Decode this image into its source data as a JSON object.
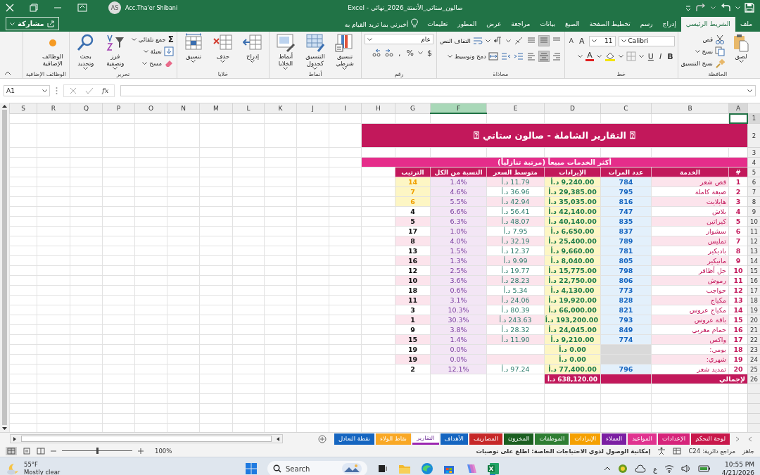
{
  "window": {
    "title": "صالون_ستاتي_الأتمتة_2026_نهائي - Excel",
    "user": "Acc.Tha'er Shibani",
    "avatar": "AS"
  },
  "ribbon_tabs": [
    {
      "label": "ملف",
      "selected": false
    },
    {
      "label": "الشريط الرئيسي",
      "selected": true
    },
    {
      "label": "إدراج",
      "selected": false
    },
    {
      "label": "رسم",
      "selected": false
    },
    {
      "label": "تخطيط الصفحة",
      "selected": false
    },
    {
      "label": "الصيغ",
      "selected": false
    },
    {
      "label": "بيانات",
      "selected": false
    },
    {
      "label": "مراجعة",
      "selected": false
    },
    {
      "label": "عرض",
      "selected": false
    },
    {
      "label": "المطور",
      "selected": false
    },
    {
      "label": "تعليمات",
      "selected": false
    }
  ],
  "tell_me": "أخبرني بما تريد القيام به",
  "share": "مشاركة",
  "ribbon_groups": [
    {
      "kind": "clipboard",
      "label": "الحافظة",
      "paste": "لصق",
      "items": [
        "قص",
        "نسخ",
        "نسخ التنسيق"
      ]
    },
    {
      "kind": "font",
      "label": "خط",
      "font": "Calibri",
      "size": "11",
      "grow": "A",
      "shrink": "A",
      "bold": "B",
      "italic": "I",
      "underline": "U",
      "font_color": "A"
    },
    {
      "kind": "alignment",
      "label": "محاذاة",
      "wrap": "التفاف النص",
      "merge": "دمج وتوسيط"
    },
    {
      "kind": "number",
      "label": "رقم",
      "format": "عام",
      "currency": "$",
      "percent": "%",
      "comma": ","
    },
    {
      "kind": "big",
      "label": "أنماط",
      "items": [
        "تنسيق شرطي",
        "التنسيق كجدول",
        "أنماط الخلايا"
      ]
    },
    {
      "kind": "big",
      "label": "خلايا",
      "items": [
        "إدراج",
        "حذف",
        "تنسيق"
      ]
    },
    {
      "kind": "editing",
      "label": "تحرير",
      "sum_symbol": "Σ",
      "items": [
        "جمع تلقائي",
        "تعبئة",
        "مسح"
      ],
      "big": [
        "فرز وتصفية",
        "بحث وتحديد"
      ]
    },
    {
      "kind": "big",
      "label": "الوظائف الإضافية",
      "items": [
        "الوظائف الإضافية"
      ]
    }
  ],
  "formula_bar": {
    "name_box": "A1",
    "fx": "fx"
  },
  "column_headers": [
    {
      "label": "A",
      "selected": true,
      "highlighted": false
    },
    {
      "label": "B",
      "selected": false,
      "highlighted": false
    },
    {
      "label": "C",
      "selected": false,
      "highlighted": false
    },
    {
      "label": "D",
      "selected": false,
      "highlighted": false
    },
    {
      "label": "E",
      "selected": false,
      "highlighted": false
    },
    {
      "label": "F",
      "selected": false,
      "highlighted": true
    },
    {
      "label": "G",
      "selected": false,
      "highlighted": false
    },
    {
      "label": "H",
      "selected": false,
      "highlighted": false
    },
    {
      "label": "I",
      "selected": false,
      "highlighted": false
    },
    {
      "label": "J",
      "selected": false,
      "highlighted": false
    },
    {
      "label": "K",
      "selected": false,
      "highlighted": false
    },
    {
      "label": "L",
      "selected": false,
      "highlighted": false
    },
    {
      "label": "M",
      "selected": false,
      "highlighted": false
    },
    {
      "label": "N",
      "selected": false,
      "highlighted": false
    },
    {
      "label": "O",
      "selected": false,
      "highlighted": false
    },
    {
      "label": "P",
      "selected": false,
      "highlighted": false
    },
    {
      "label": "Q",
      "selected": false,
      "highlighted": false
    },
    {
      "label": "R",
      "selected": false,
      "highlighted": false
    },
    {
      "label": "S",
      "selected": false,
      "highlighted": false
    }
  ],
  "row_headers": [
    {
      "label": "1",
      "selected": true
    },
    {
      "label": "2",
      "selected": false
    },
    {
      "label": "3",
      "selected": false
    },
    {
      "label": "4",
      "selected": false
    },
    {
      "label": "5",
      "selected": false
    },
    {
      "label": "6",
      "selected": false
    },
    {
      "label": "7",
      "selected": false
    },
    {
      "label": "8",
      "selected": false
    },
    {
      "label": "9",
      "selected": false
    },
    {
      "label": "10",
      "selected": false
    },
    {
      "label": "11",
      "selected": false
    },
    {
      "label": "12",
      "selected": false
    },
    {
      "label": "13",
      "selected": false
    },
    {
      "label": "14",
      "selected": false
    },
    {
      "label": "15",
      "selected": false
    },
    {
      "label": "16",
      "selected": false
    },
    {
      "label": "17",
      "selected": false
    },
    {
      "label": "18",
      "selected": false
    },
    {
      "label": "19",
      "selected": false
    },
    {
      "label": "20",
      "selected": false
    },
    {
      "label": "21",
      "selected": false
    },
    {
      "label": "22",
      "selected": false
    },
    {
      "label": "23",
      "selected": false
    },
    {
      "label": "24",
      "selected": false
    },
    {
      "label": "25",
      "selected": false
    },
    {
      "label": "26",
      "selected": false
    }
  ],
  "report": {
    "title": "⍰ التقارير الشاملة - صالون ستاتي ⍰",
    "subtitle": "أكثر الخدمات مبيعاً (مرتبة تنازلياً)",
    "headers": [
      "#",
      "الخدمة",
      "عدد المرات",
      "الإيرادات",
      "متوسط السعر",
      "النسبة من الكل",
      "الترتيب"
    ],
    "rows": [
      {
        "n": "1",
        "service": "قص شعر",
        "count": "784",
        "revenue": "9,240.00 د.أ",
        "avg_price": "11.79 د.أ",
        "share": "1.4%",
        "rank": "14",
        "highlight": true
      },
      {
        "n": "2",
        "service": "صبغة كاملة",
        "count": "795",
        "revenue": "29,385.00 د.أ",
        "avg_price": "36.96 د.أ",
        "share": "4.6%",
        "rank": "7",
        "highlight": true
      },
      {
        "n": "3",
        "service": "هايلايت",
        "count": "816",
        "revenue": "35,035.00 د.أ",
        "avg_price": "42.94 د.أ",
        "share": "5.5%",
        "rank": "6",
        "highlight": true
      },
      {
        "n": "4",
        "service": "بلاش",
        "count": "747",
        "revenue": "42,140.00 د.أ",
        "avg_price": "56.41 د.أ",
        "share": "6.6%",
        "rank": "4",
        "highlight": false
      },
      {
        "n": "5",
        "service": "كيراتين",
        "count": "835",
        "revenue": "40,140.00 د.أ",
        "avg_price": "48.07 د.أ",
        "share": "6.3%",
        "rank": "5",
        "highlight": false
      },
      {
        "n": "6",
        "service": "سشوار",
        "count": "837",
        "revenue": "6,650.00 د.أ",
        "avg_price": "7.95 د.أ",
        "share": "1.0%",
        "rank": "17",
        "highlight": false
      },
      {
        "n": "7",
        "service": "تمليس",
        "count": "789",
        "revenue": "25,400.00 د.أ",
        "avg_price": "32.19 د.أ",
        "share": "4.0%",
        "rank": "8",
        "highlight": false
      },
      {
        "n": "8",
        "service": "باديكير",
        "count": "781",
        "revenue": "9,660.00 د.أ",
        "avg_price": "12.37 د.أ",
        "share": "1.5%",
        "rank": "13",
        "highlight": false
      },
      {
        "n": "9",
        "service": "مانيكير",
        "count": "805",
        "revenue": "8,040.00 د.أ",
        "avg_price": "9.99 د.أ",
        "share": "1.3%",
        "rank": "16",
        "highlight": false
      },
      {
        "n": "10",
        "service": "جل أظافر",
        "count": "798",
        "revenue": "15,775.00 د.أ",
        "avg_price": "19.77 د.أ",
        "share": "2.5%",
        "rank": "12",
        "highlight": false
      },
      {
        "n": "11",
        "service": "رموش",
        "count": "806",
        "revenue": "22,750.00 د.أ",
        "avg_price": "28.23 د.أ",
        "share": "3.6%",
        "rank": "10",
        "highlight": false
      },
      {
        "n": "12",
        "service": "حواجب",
        "count": "773",
        "revenue": "4,130.00 د.أ",
        "avg_price": "5.34 د.أ",
        "share": "0.6%",
        "rank": "18",
        "highlight": false
      },
      {
        "n": "13",
        "service": "مكياج",
        "count": "828",
        "revenue": "19,920.00 د.أ",
        "avg_price": "24.06 د.أ",
        "share": "3.1%",
        "rank": "11",
        "highlight": false
      },
      {
        "n": "14",
        "service": "مكياج عروس",
        "count": "821",
        "revenue": "66,000.00 د.أ",
        "avg_price": "80.39 د.أ",
        "share": "10.3%",
        "rank": "3",
        "highlight": false
      },
      {
        "n": "15",
        "service": "باقة عروس",
        "count": "793",
        "revenue": "193,200.00 د.أ",
        "avg_price": "243.63 د.أ",
        "share": "30.3%",
        "rank": "1",
        "highlight": false
      },
      {
        "n": "16",
        "service": "حمام مغربي",
        "count": "849",
        "revenue": "24,045.00 د.أ",
        "avg_price": "28.32 د.أ",
        "share": "3.8%",
        "rank": "9",
        "highlight": false
      },
      {
        "n": "17",
        "service": "واكس",
        "count": "774",
        "revenue": "9,210.00 د.أ",
        "avg_price": "11.90 د.أ",
        "share": "1.4%",
        "rank": "15",
        "highlight": false
      },
      {
        "n": "18",
        "service": "يومي:",
        "revenue": "0.00 د.أ",
        "share": "0.0%",
        "rank": "19",
        "highlight": false
      },
      {
        "n": "19",
        "service": "شهري:",
        "revenue": "0.00 د.أ",
        "share": "0.0%",
        "rank": "19",
        "highlight": false
      },
      {
        "n": "20",
        "service": "تمديد شعر",
        "count": "796",
        "revenue": "77,400.00 د.أ",
        "avg_price": "97.24 د.أ",
        "share": "12.1%",
        "rank": "2",
        "highlight": false
      }
    ],
    "total_label": "لإجمالي",
    "total": "638,120.00 د.أ"
  },
  "sheet_tabs": [
    {
      "label": "لوحة التحكم",
      "color": "#c8174a",
      "selected": false
    },
    {
      "label": "الإعدادات",
      "color": "#d6247a",
      "selected": false
    },
    {
      "label": "المواعيد",
      "color": "#e0338f",
      "selected": false
    },
    {
      "label": "العملاء",
      "color": "#7b1fa2",
      "selected": false
    },
    {
      "label": "الإيرادات",
      "color": "#f5a000",
      "selected": false
    },
    {
      "label": "الموظفات",
      "color": "#2e7d32",
      "selected": false
    },
    {
      "label": "المخزون",
      "color": "#1b5e20",
      "selected": false
    },
    {
      "label": "المصاريف",
      "color": "#c62828",
      "selected": false
    },
    {
      "label": "الأهداف",
      "color": "#1565c0",
      "selected": false
    },
    {
      "label": "التقارير",
      "color": "#9c27b0",
      "selected": true
    },
    {
      "label": "نقاط الولاء",
      "color": "#f9a825",
      "selected": false
    },
    {
      "label": "نقطة التعادل",
      "color": "#1565c0",
      "selected": false
    }
  ],
  "status_bar": {
    "ready": "جاهز",
    "circular": "مراجع دائرية: C24",
    "accessibility": "إمكانية الوصول لذوي الاحتياجات الخاصة: اطلع على توصيات",
    "zoom": "100%",
    "zoom_slider": {
      "level": 0.5
    }
  },
  "taskbar": {
    "temperature": "55°F",
    "weather": "Mostly clear",
    "search": "Search",
    "keyboard": "ع",
    "time": "10:55 PM",
    "date": "4/21/2026"
  }
}
